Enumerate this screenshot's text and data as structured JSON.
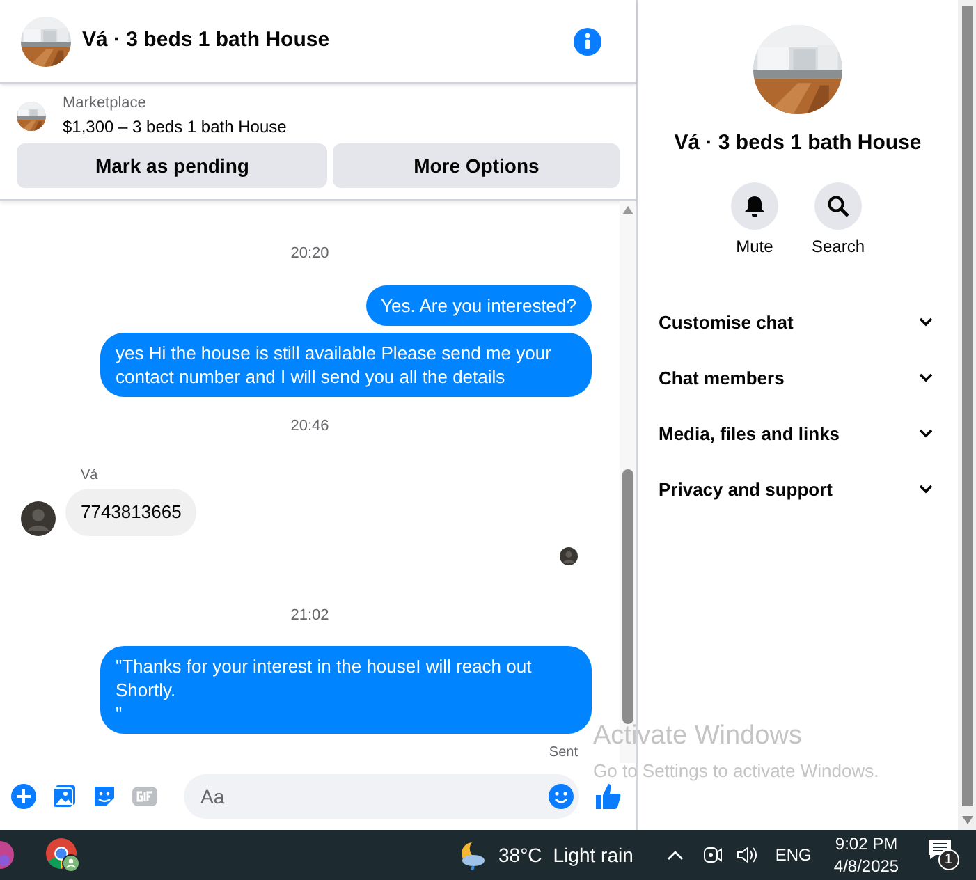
{
  "chat": {
    "title": "Vá · 3 beds 1 bath House",
    "listing": {
      "source": "Marketplace",
      "summary": "$1,300 – 3 beds 1 bath House"
    },
    "buttons": [
      "Mark as pending",
      "More Options"
    ],
    "messages": [
      {
        "kind": "timestamp",
        "text": "20:20"
      },
      {
        "kind": "outgoing",
        "text": "Yes. Are you interested?"
      },
      {
        "kind": "outgoing",
        "text": "yes Hi the house is still available Please send me your contact number and I will send you all the details"
      },
      {
        "kind": "timestamp",
        "text": "20:46"
      },
      {
        "kind": "incoming",
        "sender": "Vá",
        "text": "7743813665"
      },
      {
        "kind": "seen"
      },
      {
        "kind": "timestamp",
        "text": "21:02"
      },
      {
        "kind": "outgoing",
        "text": "\"Thanks for your interest in the houseI will reach out Shortly.\n\""
      },
      {
        "kind": "status",
        "text": "Sent"
      }
    ],
    "composer": {
      "placeholder": "Aa"
    }
  },
  "details": {
    "title": "Vá · 3 beds 1 bath House",
    "actions": [
      {
        "kind": "mute",
        "label": "Mute"
      },
      {
        "kind": "search",
        "label": "Search"
      }
    ],
    "sections": [
      {
        "label": "Customise chat",
        "expanded": false
      },
      {
        "label": "Chat members",
        "expanded": false
      },
      {
        "label": "Media, files and links",
        "expanded": false
      },
      {
        "label": "Privacy and support",
        "expanded": false
      }
    ]
  },
  "activation_notice": {
    "title": "Activate Windows",
    "subtitle": "Go to Settings to activate Windows."
  },
  "taskbar": {
    "temperature": "38°C",
    "weather": "Light rain",
    "language": "ENG",
    "time": "9:02 PM",
    "date": "4/8/2025",
    "notifications": "1"
  }
}
